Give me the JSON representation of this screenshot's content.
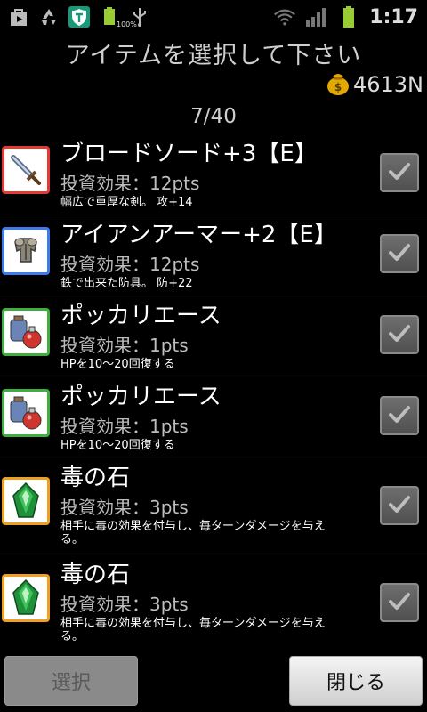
{
  "status_bar": {
    "time": "1:17",
    "battery_percent": "100%",
    "icons": [
      "shopping-bag-icon",
      "recycle-icon",
      "shield-t-icon",
      "battery-full-icon",
      "usb-icon",
      "wifi-icon",
      "signal-icon",
      "battery-icon"
    ]
  },
  "dialog": {
    "title": "アイテムを選択して下さい",
    "gold": "4613N",
    "page_counter": "7/40"
  },
  "items": [
    {
      "name": "ブロードソード+3【E】",
      "invest": "投資効果：12pts",
      "desc": "幅広で重厚な剣。 攻+14",
      "icon": "sword-icon",
      "frame_color": "#e53935",
      "checked": true
    },
    {
      "name": "アイアンアーマー+2【E】",
      "invest": "投資効果：12pts",
      "desc": "鉄で出来た防具。 防+22",
      "icon": "armor-icon",
      "frame_color": "#3d7bea",
      "checked": true
    },
    {
      "name": "ポッカリエース",
      "invest": "投資効果：1pts",
      "desc": "HPを10～20回復する",
      "icon": "potion-icon",
      "frame_color": "#3fae3f",
      "checked": true
    },
    {
      "name": "ポッカリエース",
      "invest": "投資効果：1pts",
      "desc": "HPを10～20回復する",
      "icon": "potion-icon",
      "frame_color": "#3fae3f",
      "checked": true
    },
    {
      "name": "毒の石",
      "invest": "投資効果：3pts",
      "desc": "相手に毒の効果を付与し、毎ターンダメージを与え\nる。",
      "icon": "poison-stone-icon",
      "frame_color": "#f0a020",
      "checked": true
    },
    {
      "name": "毒の石",
      "invest": "投資効果：3pts",
      "desc": "相手に毒の効果を付与し、毎ターンダメージを与え\nる。",
      "icon": "poison-stone-icon",
      "frame_color": "#f0a020",
      "checked": true
    }
  ],
  "buttons": {
    "select_label": "選択",
    "close_label": "閉じる"
  }
}
